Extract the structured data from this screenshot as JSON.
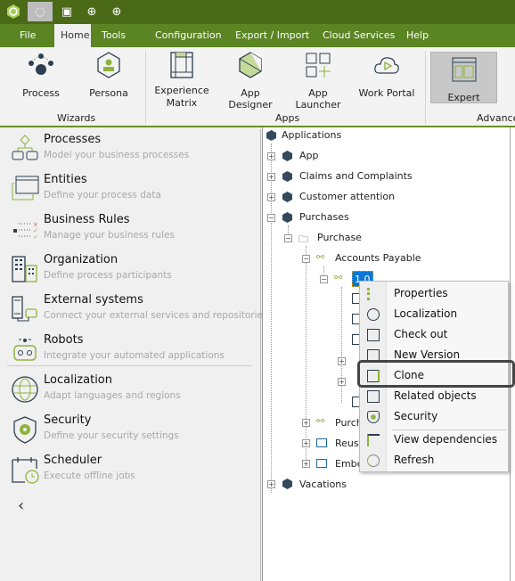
{
  "menu": {
    "items": [
      "File",
      "Home",
      "Tools",
      "Configuration",
      "Export / Import",
      "Cloud Services",
      "Help"
    ],
    "active": "Home"
  },
  "ribbon": {
    "buttons": [
      {
        "label": "Process",
        "icon": "process-icon"
      },
      {
        "label": "Persona",
        "icon": "persona-icon"
      },
      {
        "label": "Experience Matrix",
        "icon": "experience-matrix-icon"
      },
      {
        "label": "App Designer",
        "icon": "app-designer-icon"
      },
      {
        "label": "App Launcher",
        "icon": "app-launcher-icon"
      },
      {
        "label": "Work Portal",
        "icon": "work-portal-icon"
      },
      {
        "label": "Expert",
        "icon": "expert-icon",
        "selected": true
      }
    ],
    "groups": [
      "Wizards",
      "Apps",
      "Advanced"
    ]
  },
  "left": {
    "items": [
      {
        "title": "Processes",
        "desc": "Model your business processes"
      },
      {
        "title": "Entities",
        "desc": "Define your process data"
      },
      {
        "title": "Business Rules",
        "desc": "Manage your business rules"
      },
      {
        "title": "Organization",
        "desc": "Define process participants"
      },
      {
        "title": "External systems",
        "desc": "Connect your external services and repositories"
      },
      {
        "title": "Robots",
        "desc": "Integrate your automated applications"
      },
      {
        "title": "Localization",
        "desc": "Adapt languages and regions"
      },
      {
        "title": "Security",
        "desc": "Define your security settings"
      },
      {
        "title": "Scheduler",
        "desc": "Execute offline jobs"
      }
    ]
  },
  "tree": {
    "root": "Applications",
    "apps": [
      "App",
      "Claims and Complaints",
      "Customer attention",
      "Purchases"
    ],
    "purchase": "Purchase",
    "accounts_payable": "Accounts Payable",
    "version": "1.0",
    "purch_children": [
      "Purcha",
      "Reusa",
      "Embe"
    ],
    "vacations": "Vacations"
  },
  "context_menu": {
    "items": [
      "Properties",
      "Localization",
      "Check out",
      "New Version",
      "Clone",
      "Related objects",
      "Security",
      "View dependencies",
      "Refresh"
    ],
    "highlighted": "Clone"
  },
  "colors": {
    "titlebar": "#4b6a17",
    "menubar": "#5b8423",
    "accent": "#8db33a",
    "selection": "#0a78d7"
  }
}
